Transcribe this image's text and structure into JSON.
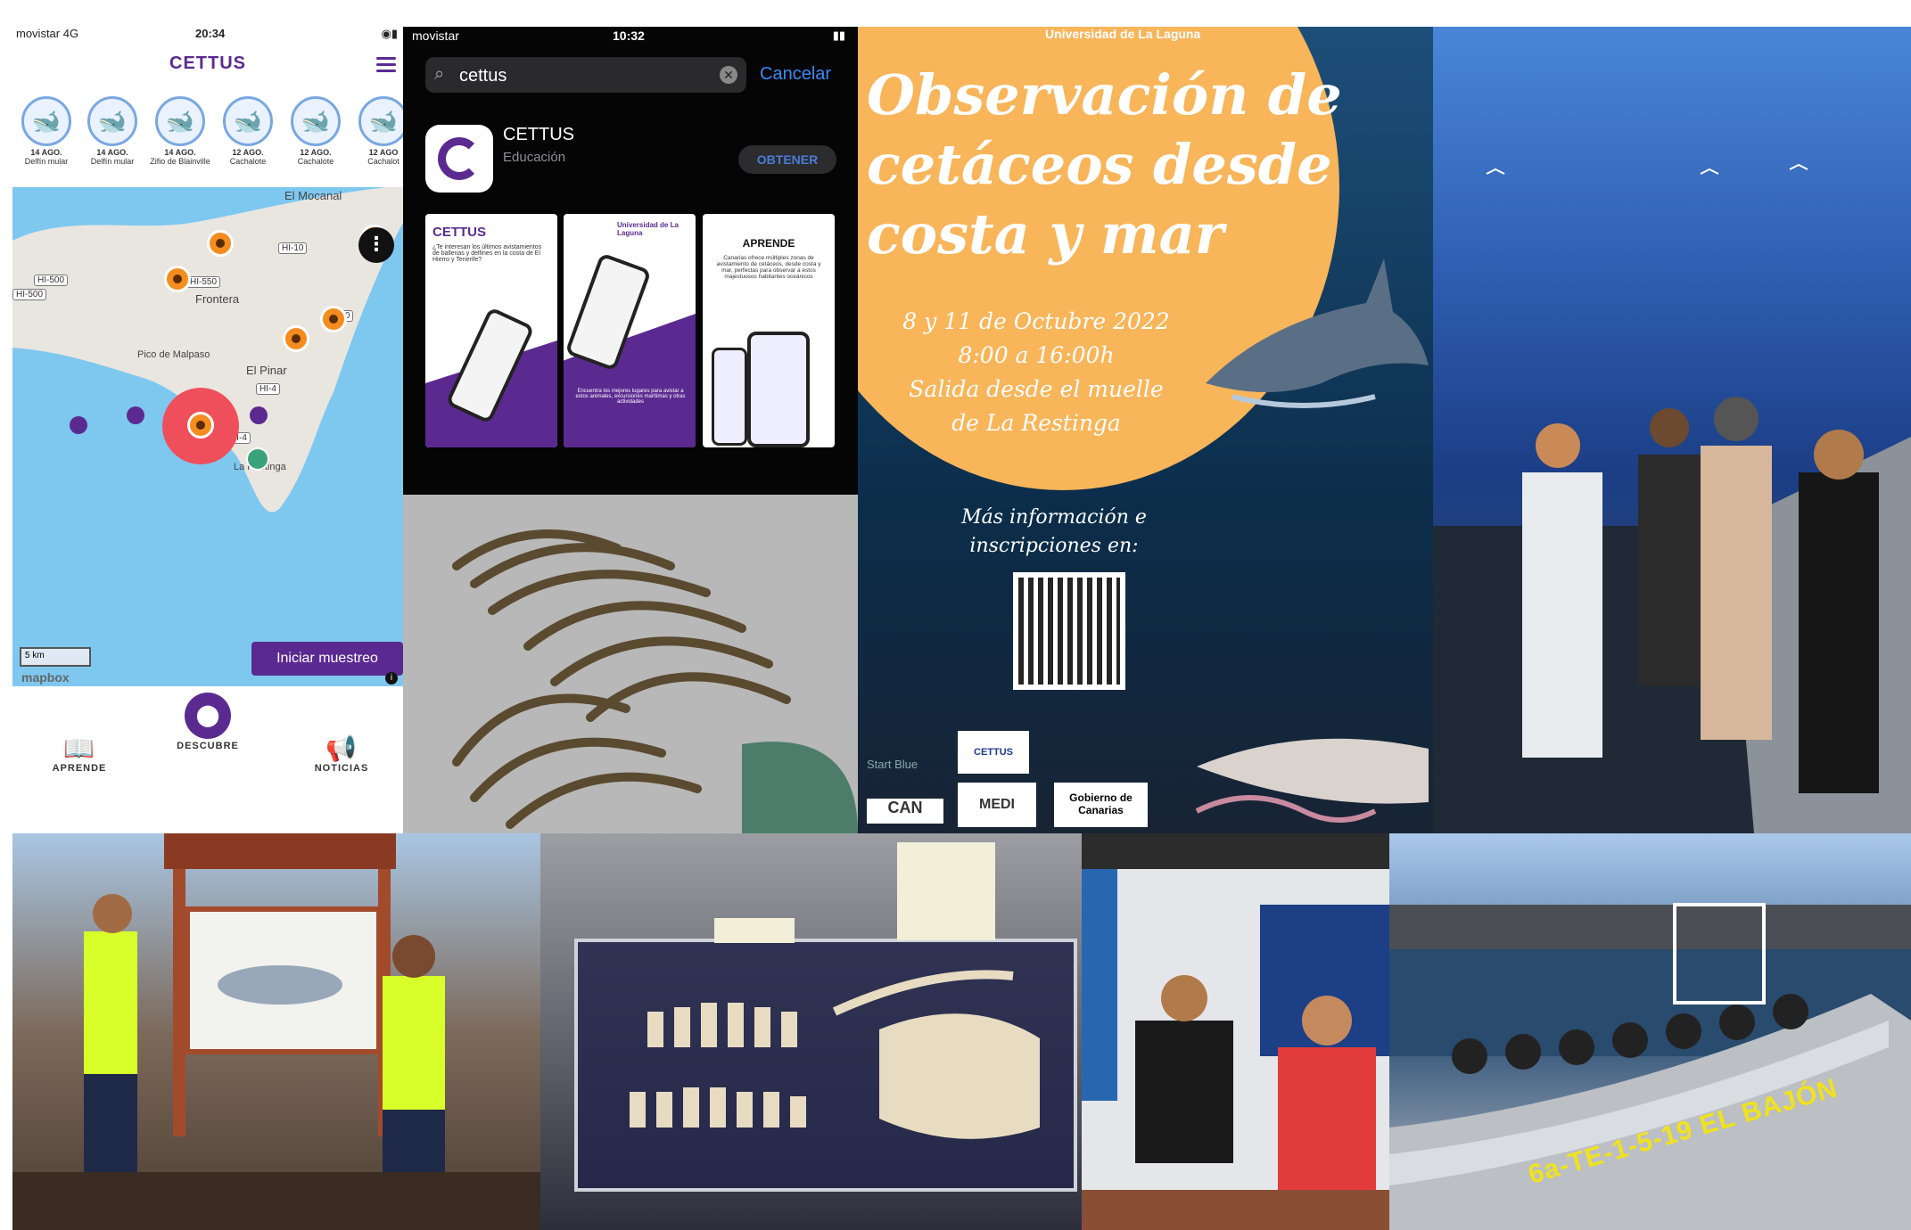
{
  "app": {
    "status_left": "movistar 4G",
    "status_time": "20:34",
    "title": "CETTUS",
    "sightings": [
      {
        "date": "14 AGO.",
        "name": "Delfín mular"
      },
      {
        "date": "14 AGO.",
        "name": "Delfín mular"
      },
      {
        "date": "14 AGO.",
        "name": "Zifio de Blainville"
      },
      {
        "date": "12 AGO.",
        "name": "Cachalote"
      },
      {
        "date": "12 AGO.",
        "name": "Cachalote"
      },
      {
        "date": "12 AGO",
        "name": "Cachalot"
      }
    ],
    "map": {
      "places": [
        "El Mocanal",
        "Frontera",
        "Pico de Malpaso",
        "El Pinar",
        "La Restinga"
      ],
      "roads": [
        "HI-10",
        "HI-500",
        "HI-550",
        "HI-500",
        "HI-30",
        "HI-4",
        "HI-4"
      ],
      "scale": "5 km",
      "start_button": "Iniciar muestreo",
      "attribution": "mapbox",
      "info": "i"
    },
    "tabs": [
      "APRENDE",
      "DESCUBRE",
      "NOTICIAS"
    ]
  },
  "store": {
    "status_left": "movistar",
    "status_time": "10:32",
    "search_value": "cettus",
    "cancel_label": "Cancelar",
    "app_name": "CETTUS",
    "app_category": "Educación",
    "get_label": "OBTENER",
    "shot1_title": "CETTUS",
    "shot1_text": "¿Te interesan los últimos avistamientos de ballenas y delfines en la costa de El Hierro y Tenerife?",
    "shot2_logo": "Universidad de La Laguna",
    "shot2_text": "Encuentra los mejores lugares para avistar a estos animales, excursiones marítimas y otras actividades",
    "shot3_title": "APRENDE",
    "shot3_text": "Canarias ofrece múltiples zonas de avistamiento de cetáceos, desde costa y mar, perfectas para observar a estos majestuosos habitantes oceánicos"
  },
  "poster": {
    "logo": "Universidad de La Laguna",
    "headline": [
      "Observación de",
      "cetáceos desde",
      "costa y mar"
    ],
    "details": [
      "8 y 11 de Octubre 2022",
      "8:00 a 16:00h",
      "Salida desde el muelle",
      "de La Restinga"
    ],
    "more_info": [
      "Más información e",
      "inscripciones en:"
    ],
    "sponsors": [
      "CETTUS",
      "Start Blue",
      "CAN",
      "MEDI",
      "Gobierno de Canarias"
    ]
  },
  "boat2": {
    "hull_text": "6a-TE-1-5-19 EL BAJÓN"
  },
  "colors": {
    "brand_purple": "#5b2a91",
    "poster_orange": "#f8b55a",
    "obtain_blue": "#4a7bd6",
    "map_water": "#7ec8f0",
    "pin_orange": "#f58c1f",
    "hotspot_red": "#ef4f5a"
  }
}
